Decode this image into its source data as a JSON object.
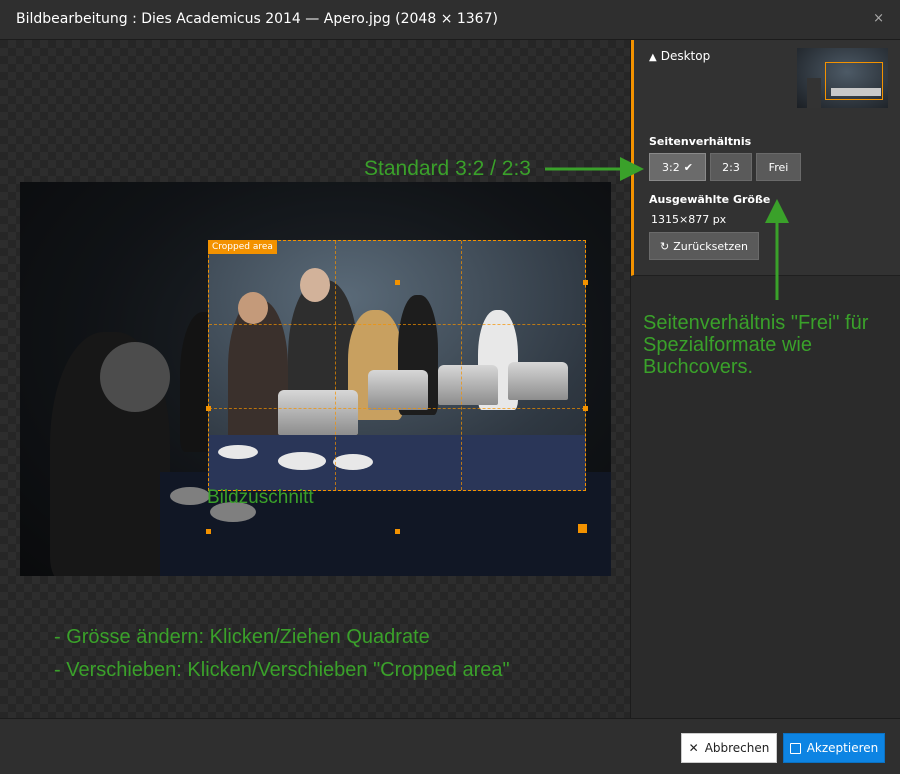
{
  "window": {
    "title": "Bildbearbeitung : Dies Academicus 2014 — Apero.jpg (2048 × 1367)",
    "close_glyph": "×"
  },
  "editor": {
    "crop_label": "Cropped area"
  },
  "sidebar": {
    "preset_name": "Desktop",
    "aspect_ratio_heading": "Seitenverhältnis",
    "ratios": [
      {
        "label": "3:2",
        "selected": true
      },
      {
        "label": "2:3",
        "selected": false
      },
      {
        "label": "Frei",
        "selected": false
      }
    ],
    "selected_size_heading": "Ausgewählte Größe",
    "selected_size_value": "1315×877 px",
    "reset_label": "Zurücksetzen"
  },
  "annotations": {
    "standard": "Standard 3:2 / 2:3",
    "frei": "Seitenverhältnis \"Frei\" für Spezialformate wie Buchcovers.",
    "bildzuschnitt": "Bildzuschnitt",
    "groesse": "- Grösse ändern: Klicken/Ziehen Quadrate",
    "verschieben": "- Verschieben: Klicken/Verschieben \"Cropped area\""
  },
  "footer": {
    "cancel_label": "Abbrechen",
    "accept_label": "Akzeptieren"
  },
  "colors": {
    "accent": "#f39200",
    "annotation": "#3aa12a",
    "primary_button": "#0d84e3"
  },
  "icons": {
    "collapse": "chevron-up-icon",
    "checkmark": "check-icon",
    "reset": "refresh-icon",
    "cancel": "close-icon",
    "accept": "save-icon"
  }
}
